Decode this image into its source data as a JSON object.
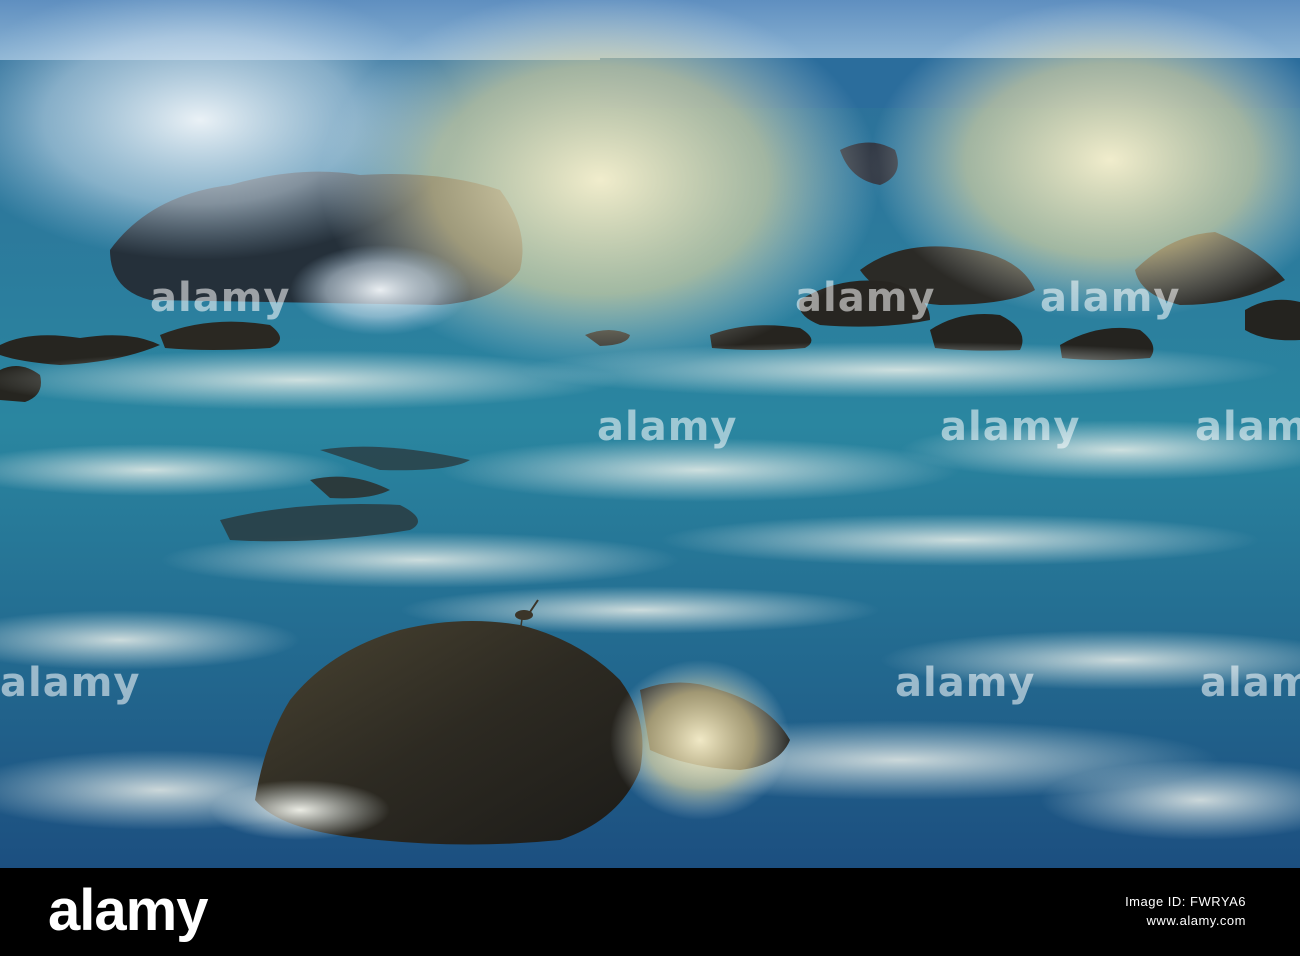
{
  "brand": {
    "logo_text": "alamy",
    "watermark_text": "alamy"
  },
  "footer": {
    "image_id": "Image ID: FWRYA6",
    "domain": "www.alamy.com"
  },
  "colors": {
    "sky": "#6f9fc7",
    "sea_deep": "#1e5f88",
    "sea_teal": "#2f8fa8",
    "foam": "#e8efe9",
    "spray_warm": "#f3e7b2",
    "rock": "#2e2a22",
    "footer_bg": "#000000"
  }
}
